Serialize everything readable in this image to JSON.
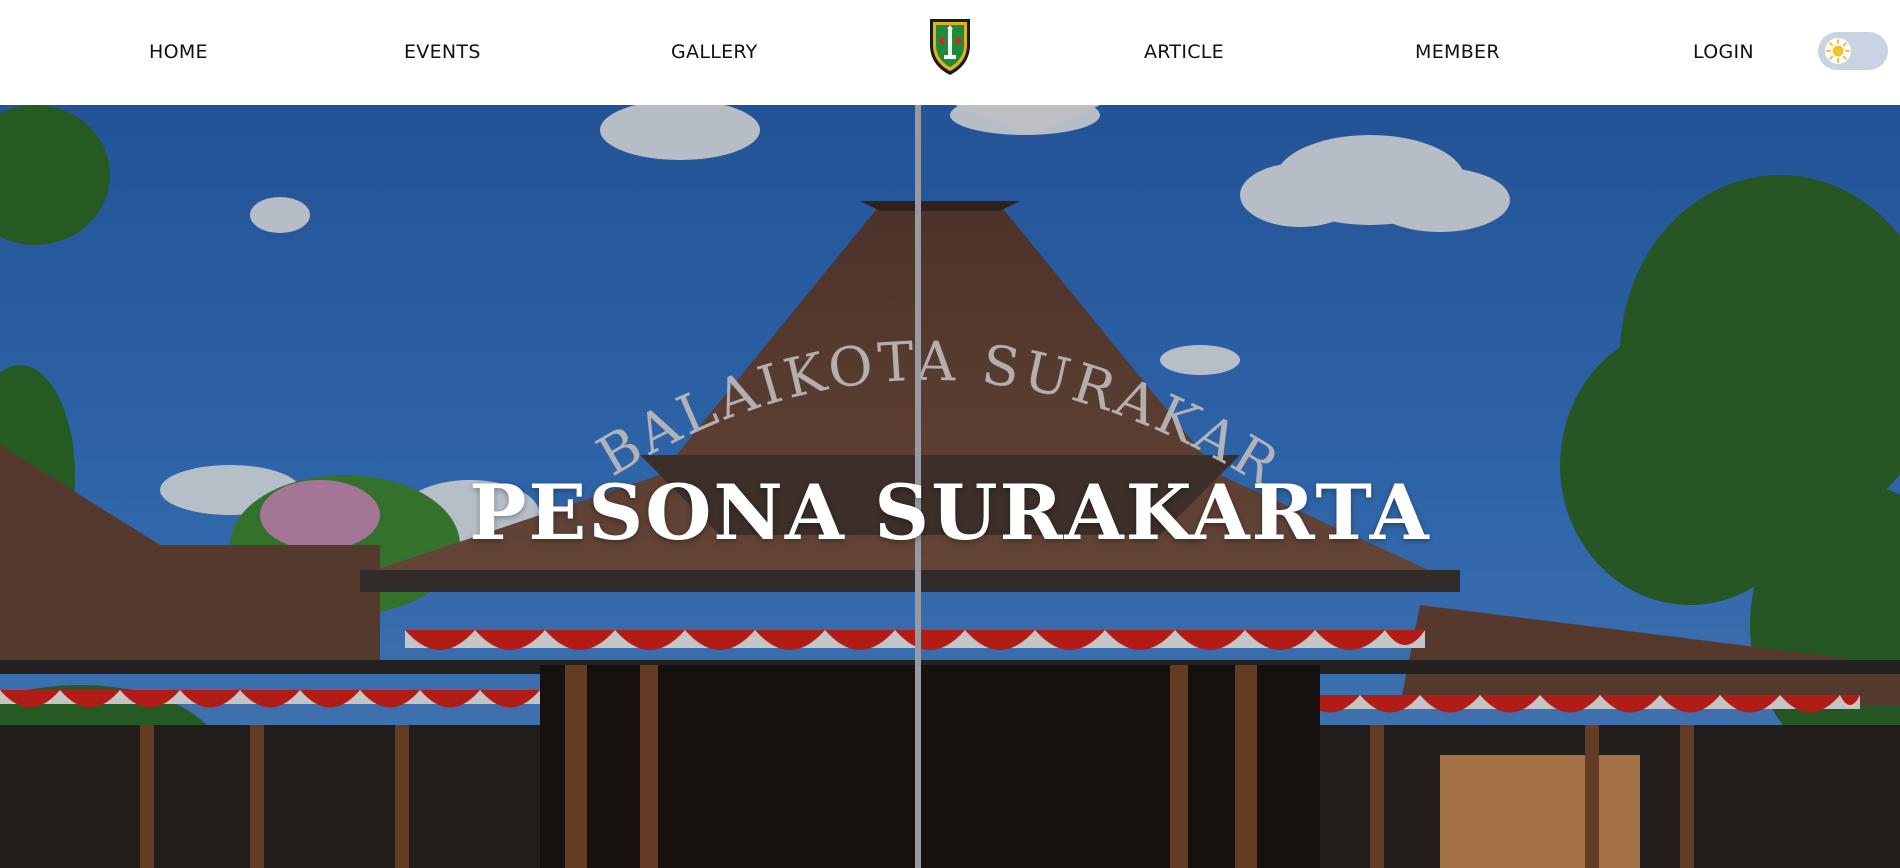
{
  "nav": {
    "home": "HOME",
    "events": "EVENTS",
    "gallery": "GALLERY",
    "article": "ARTICLE",
    "member": "MEMBER",
    "login": "LOGIN"
  },
  "logo": {
    "icon": "surakarta-crest-icon"
  },
  "theme_toggle": {
    "icon": "sun-icon",
    "mode": "light"
  },
  "hero": {
    "title": "PESONA SURAKARTA",
    "sign_text": "BALAIKOTA SURAKARTA",
    "background": "photo-balaikota-surakarta-pendopo"
  },
  "colors": {
    "nav_bg": "#ffffff",
    "nav_text": "#111111",
    "toggle_track": "#c9d3e1",
    "sun": "#f2c230",
    "sky": "#2f6fc0",
    "roof": "#6e4a3c",
    "flag_red": "#d8241b",
    "flag_white": "#f2f2f2"
  }
}
